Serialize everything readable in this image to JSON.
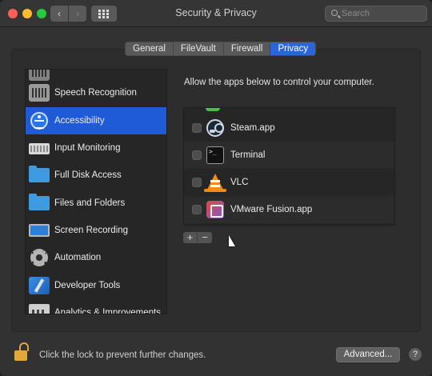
{
  "window": {
    "title": "Security & Privacy"
  },
  "toolbar": {
    "back": "‹",
    "forward": "›"
  },
  "search": {
    "placeholder": "Search"
  },
  "tabs": [
    {
      "label": "General",
      "active": false
    },
    {
      "label": "FileVault",
      "active": false
    },
    {
      "label": "Firewall",
      "active": false
    },
    {
      "label": "Privacy",
      "active": true
    }
  ],
  "sidebar": {
    "items": [
      {
        "label": "Speech Recognition",
        "icon": "speech-recognition-icon",
        "selected": false
      },
      {
        "label": "Accessibility",
        "icon": "accessibility-icon",
        "selected": true
      },
      {
        "label": "Input Monitoring",
        "icon": "keyboard-icon",
        "selected": false
      },
      {
        "label": "Full Disk Access",
        "icon": "folder-icon",
        "selected": false
      },
      {
        "label": "Files and Folders",
        "icon": "folder-icon",
        "selected": false
      },
      {
        "label": "Screen Recording",
        "icon": "display-icon",
        "selected": false
      },
      {
        "label": "Automation",
        "icon": "gear-icon",
        "selected": false
      },
      {
        "label": "Developer Tools",
        "icon": "developer-tools-icon",
        "selected": false
      },
      {
        "label": "Analytics & Improvements",
        "icon": "analytics-icon",
        "selected": false
      }
    ]
  },
  "main": {
    "description": "Allow the apps below to control your computer.",
    "apps": [
      {
        "name": "Steam.app",
        "icon": "steam-icon",
        "checked": false
      },
      {
        "name": "Terminal",
        "icon": "terminal-icon",
        "checked": false
      },
      {
        "name": "VLC",
        "icon": "vlc-icon",
        "checked": false
      },
      {
        "name": "VMware Fusion.app",
        "icon": "vmware-fusion-icon",
        "checked": false
      }
    ],
    "add_label": "+",
    "remove_label": "−"
  },
  "footer": {
    "lock_text": "Click the lock to prevent further changes.",
    "advanced_label": "Advanced...",
    "help_label": "?"
  },
  "colors": {
    "accent": "#2b66d9",
    "selection": "#1f5bd6",
    "lock": "#e2a73a"
  }
}
